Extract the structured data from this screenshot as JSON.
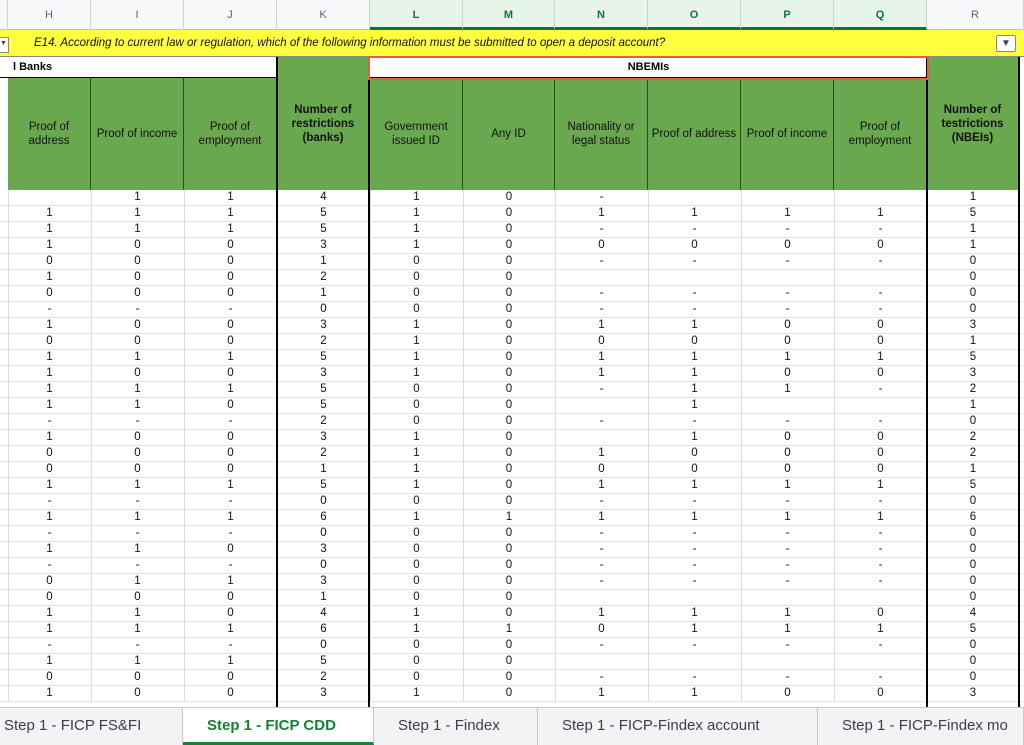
{
  "columns": [
    "H",
    "I",
    "J",
    "K",
    "L",
    "M",
    "N",
    "O",
    "P",
    "Q",
    "R"
  ],
  "selected_columns": [
    "L",
    "M",
    "N",
    "O",
    "P",
    "Q"
  ],
  "question": "E14. According to current law or regulation, which of the following information must be submitted to open a deposit account?",
  "sections": {
    "banks": "l Banks",
    "nbemis": "NBEMIs"
  },
  "headers": [
    "Proof of address",
    "Proof of income",
    "Proof of employment",
    "Number of restrictions (banks)",
    "Government issued ID",
    "Any ID",
    "Nationality or legal status",
    "Proof of address",
    "Proof of income",
    "Proof of employment",
    "Number of testrictions (NBEIs)"
  ],
  "rows": [
    [
      "",
      "1",
      "1",
      "4",
      "1",
      "0",
      "-",
      "",
      "",
      "",
      "1"
    ],
    [
      "1",
      "1",
      "1",
      "5",
      "1",
      "0",
      "1",
      "1",
      "1",
      "1",
      "5"
    ],
    [
      "1",
      "1",
      "1",
      "5",
      "1",
      "0",
      "-",
      "-",
      "-",
      "-",
      "1"
    ],
    [
      "1",
      "0",
      "0",
      "3",
      "1",
      "0",
      "0",
      "0",
      "0",
      "0",
      "1"
    ],
    [
      "0",
      "0",
      "0",
      "1",
      "0",
      "0",
      "-",
      "-",
      "-",
      "-",
      "0"
    ],
    [
      "1",
      "0",
      "0",
      "2",
      "0",
      "0",
      "",
      "",
      "",
      "",
      "0"
    ],
    [
      "0",
      "0",
      "0",
      "1",
      "0",
      "0",
      "-",
      "-",
      "-",
      "-",
      "0"
    ],
    [
      "-",
      "-",
      "-",
      "0",
      "0",
      "0",
      "-",
      "-",
      "-",
      "-",
      "0"
    ],
    [
      "1",
      "0",
      "0",
      "3",
      "1",
      "0",
      "1",
      "1",
      "0",
      "0",
      "3"
    ],
    [
      "0",
      "0",
      "0",
      "2",
      "1",
      "0",
      "0",
      "0",
      "0",
      "0",
      "1"
    ],
    [
      "1",
      "1",
      "1",
      "5",
      "1",
      "0",
      "1",
      "1",
      "1",
      "1",
      "5"
    ],
    [
      "1",
      "0",
      "0",
      "3",
      "1",
      "0",
      "1",
      "1",
      "0",
      "0",
      "3"
    ],
    [
      "1",
      "1",
      "1",
      "5",
      "0",
      "0",
      "-",
      "1",
      "1",
      "-",
      "2"
    ],
    [
      "1",
      "1",
      "0",
      "5",
      "0",
      "0",
      "",
      "1",
      "",
      "",
      "1"
    ],
    [
      "-",
      "-",
      "-",
      "2",
      "0",
      "0",
      "-",
      "-",
      "-",
      "-",
      "0"
    ],
    [
      "1",
      "0",
      "0",
      "3",
      "1",
      "0",
      "",
      "1",
      "0",
      "0",
      "2"
    ],
    [
      "0",
      "0",
      "0",
      "2",
      "1",
      "0",
      "1",
      "0",
      "0",
      "0",
      "2"
    ],
    [
      "0",
      "0",
      "0",
      "1",
      "1",
      "0",
      "0",
      "0",
      "0",
      "0",
      "1"
    ],
    [
      "1",
      "1",
      "1",
      "5",
      "1",
      "0",
      "1",
      "1",
      "1",
      "1",
      "5"
    ],
    [
      "-",
      "-",
      "-",
      "0",
      "0",
      "0",
      "-",
      "-",
      "-",
      "-",
      "0"
    ],
    [
      "1",
      "1",
      "1",
      "6",
      "1",
      "1",
      "1",
      "1",
      "1",
      "1",
      "6"
    ],
    [
      "-",
      "-",
      "-",
      "0",
      "0",
      "0",
      "-",
      "-",
      "-",
      "-",
      "0"
    ],
    [
      "1",
      "1",
      "0",
      "3",
      "0",
      "0",
      "-",
      "-",
      "-",
      "-",
      "0"
    ],
    [
      "-",
      "-",
      "-",
      "0",
      "0",
      "0",
      "-",
      "-",
      "-",
      "-",
      "0"
    ],
    [
      "0",
      "1",
      "1",
      "3",
      "0",
      "0",
      "-",
      "-",
      "-",
      "-",
      "0"
    ],
    [
      "0",
      "0",
      "0",
      "1",
      "0",
      "0",
      "",
      "",
      "",
      "",
      "0"
    ],
    [
      "1",
      "1",
      "0",
      "4",
      "1",
      "0",
      "1",
      "1",
      "1",
      "0",
      "4"
    ],
    [
      "1",
      "1",
      "1",
      "6",
      "1",
      "1",
      "0",
      "1",
      "1",
      "1",
      "5"
    ],
    [
      "-",
      "-",
      "-",
      "0",
      "0",
      "0",
      "-",
      "-",
      "-",
      "-",
      "0"
    ],
    [
      "1",
      "1",
      "1",
      "5",
      "0",
      "0",
      "",
      "",
      "",
      "",
      "0"
    ],
    [
      "0",
      "0",
      "0",
      "2",
      "0",
      "0",
      "-",
      "-",
      "-",
      "-",
      "0"
    ],
    [
      "1",
      "0",
      "0",
      "3",
      "1",
      "0",
      "1",
      "1",
      "0",
      "0",
      "3"
    ]
  ],
  "tabs": [
    {
      "label": "Step 1 - FICP FS&FI",
      "active": false
    },
    {
      "label": "Step 1 - FICP CDD",
      "active": true
    },
    {
      "label": "Step 1 - Findex",
      "active": false
    },
    {
      "label": "Step 1 - FICP-Findex account",
      "active": false
    },
    {
      "label": "Step 1 - FICP-Findex mo",
      "active": false
    }
  ],
  "icons": {
    "dropdown": "dropdown-arrow-icon"
  },
  "colors": {
    "question_bg": "#ffff3f",
    "header_green": "#6aa84f",
    "selection_border": "#e06040",
    "active_tab": "#188038"
  }
}
